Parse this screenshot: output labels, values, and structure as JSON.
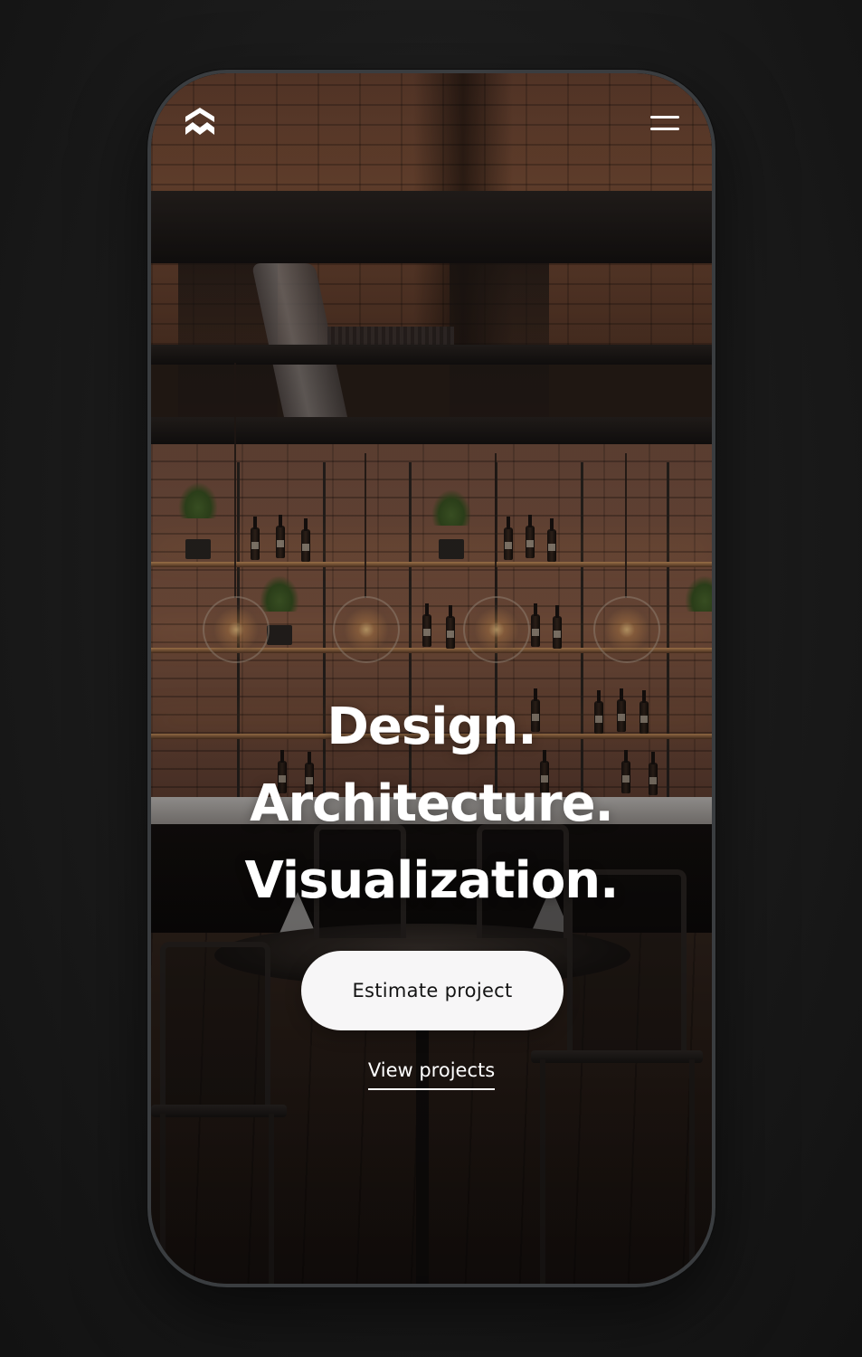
{
  "header": {
    "logo_icon": "house-roof-logo-icon",
    "menu_icon": "hamburger-menu-icon"
  },
  "hero": {
    "lines": [
      "Design.",
      "Architecture.",
      "Visualization."
    ]
  },
  "actions": {
    "primary_label": "Estimate project",
    "secondary_label": "View projects"
  },
  "colors": {
    "page_background": "#1b1b1b",
    "phone_frame": "#3a3d40",
    "button_background": "#f7f6f7",
    "button_text": "#141414",
    "text_primary": "#ffffff"
  }
}
